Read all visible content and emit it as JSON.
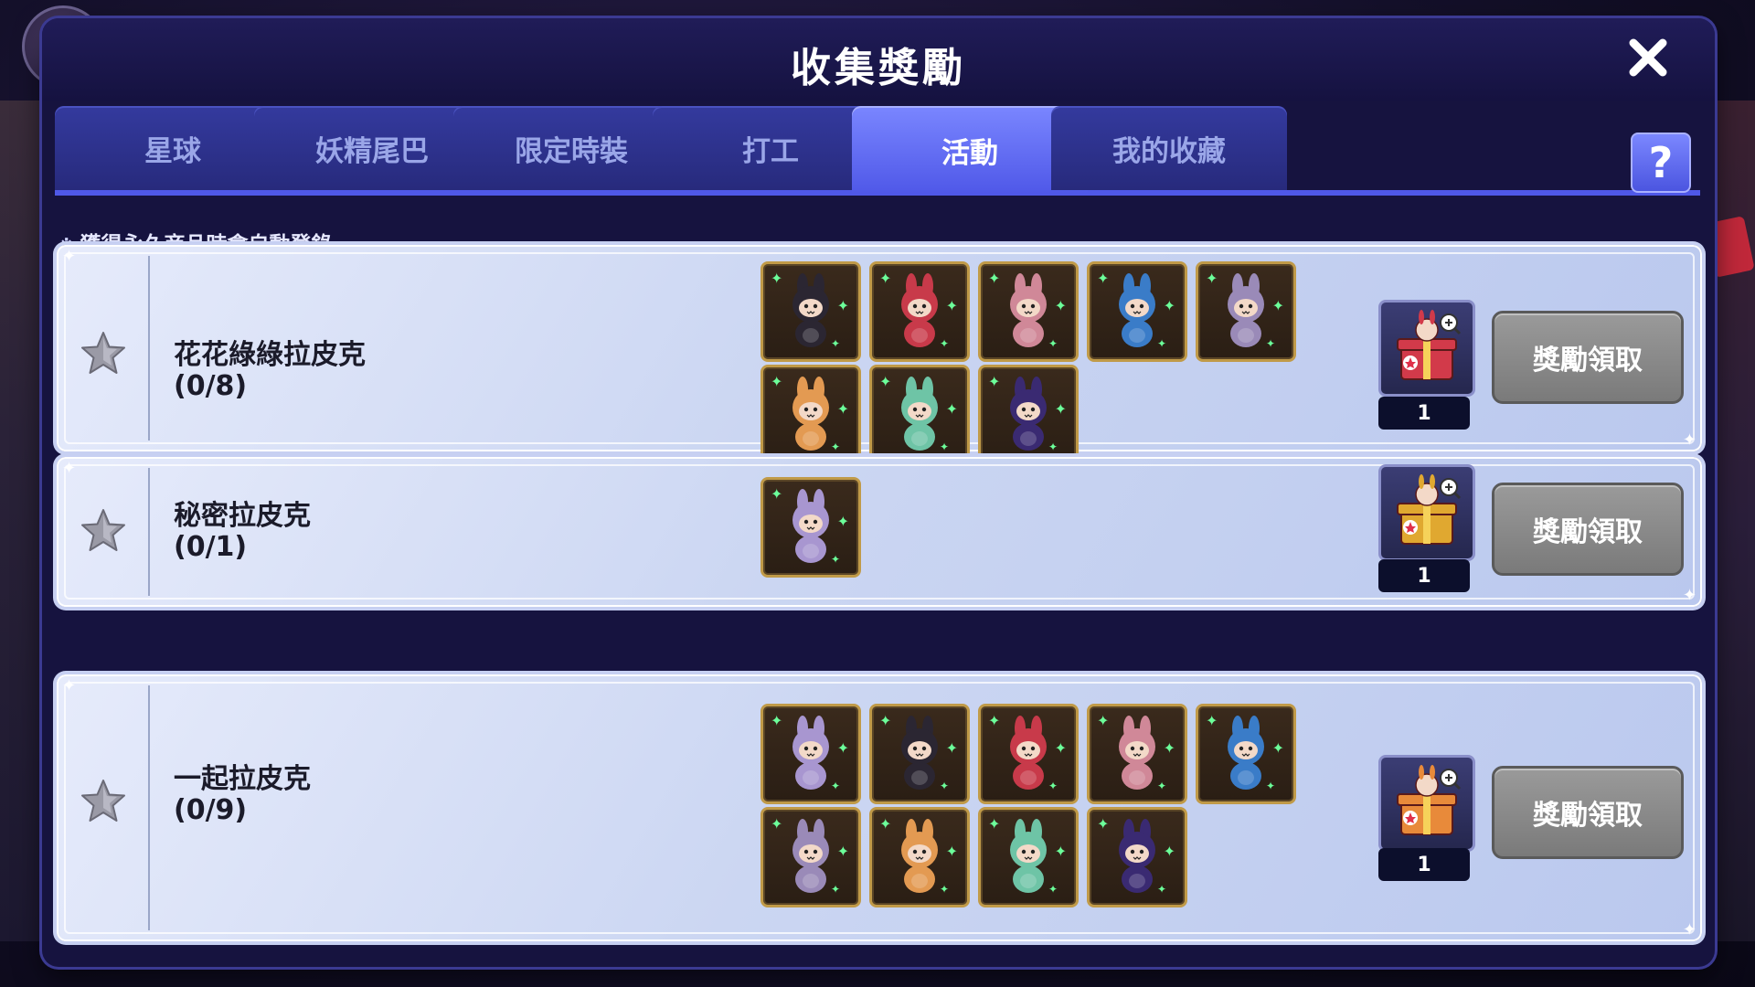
{
  "window": {
    "title": "收集獎勵"
  },
  "tabs": [
    {
      "label": "星球",
      "active": false
    },
    {
      "label": "妖精尾巴",
      "active": false
    },
    {
      "label": "限定時裝",
      "active": false
    },
    {
      "label": "打工",
      "active": false
    },
    {
      "label": "活動",
      "active": true
    },
    {
      "label": "我的收藏",
      "active": false
    }
  ],
  "help": {
    "icon": "question-mark",
    "label": "?"
  },
  "notice": {
    "mark": "※",
    "text": "獲得永久商品時會自動登錄。"
  },
  "collections": [
    {
      "name": "花花綠綠拉皮克",
      "progress": "(0/8)",
      "items": [
        {
          "icon": "labubu-black-icon",
          "color": "#2b2632"
        },
        {
          "icon": "labubu-red-icon",
          "color": "#c83a4a"
        },
        {
          "icon": "labubu-pink-icon",
          "color": "#d08898"
        },
        {
          "icon": "labubu-blue-icon",
          "color": "#3a7cc8"
        },
        {
          "icon": "labubu-lavender-icon",
          "color": "#9a8ab8"
        },
        {
          "icon": "labubu-orange-icon",
          "color": "#e39a52"
        },
        {
          "icon": "labubu-mint-icon",
          "color": "#6ec4a6"
        },
        {
          "icon": "labubu-purple-icon",
          "color": "#3a2a72"
        }
      ],
      "reward": {
        "icon": "red-gift-box-icon",
        "color": "#d23a4a",
        "count": "1"
      },
      "claim_label": "獎勵領取"
    },
    {
      "name": "秘密拉皮克",
      "progress": "(0/1)",
      "items": [
        {
          "icon": "labubu-lilac-icon",
          "color": "#a896d0"
        }
      ],
      "reward": {
        "icon": "gold-gift-box-icon",
        "color": "#e0a830",
        "count": "1"
      },
      "claim_label": "獎勵領取"
    },
    {
      "name": "一起拉皮克",
      "progress": "(0/9)",
      "items": [
        {
          "icon": "labubu-lilac-icon",
          "color": "#a896d0"
        },
        {
          "icon": "labubu-black-icon",
          "color": "#2b2632"
        },
        {
          "icon": "labubu-red-icon",
          "color": "#c83a4a"
        },
        {
          "icon": "labubu-pink-icon",
          "color": "#d08898"
        },
        {
          "icon": "labubu-blue-icon",
          "color": "#3a7cc8"
        },
        {
          "icon": "labubu-lavender-icon",
          "color": "#9a8ab8"
        },
        {
          "icon": "labubu-orange-icon",
          "color": "#e39a52"
        },
        {
          "icon": "labubu-mint-icon",
          "color": "#6ec4a6"
        },
        {
          "icon": "labubu-purple-icon",
          "color": "#3a2a72"
        }
      ],
      "reward": {
        "icon": "orange-gift-box-icon",
        "color": "#e88a3a",
        "count": "1"
      },
      "claim_label": "獎勵領取"
    }
  ]
}
